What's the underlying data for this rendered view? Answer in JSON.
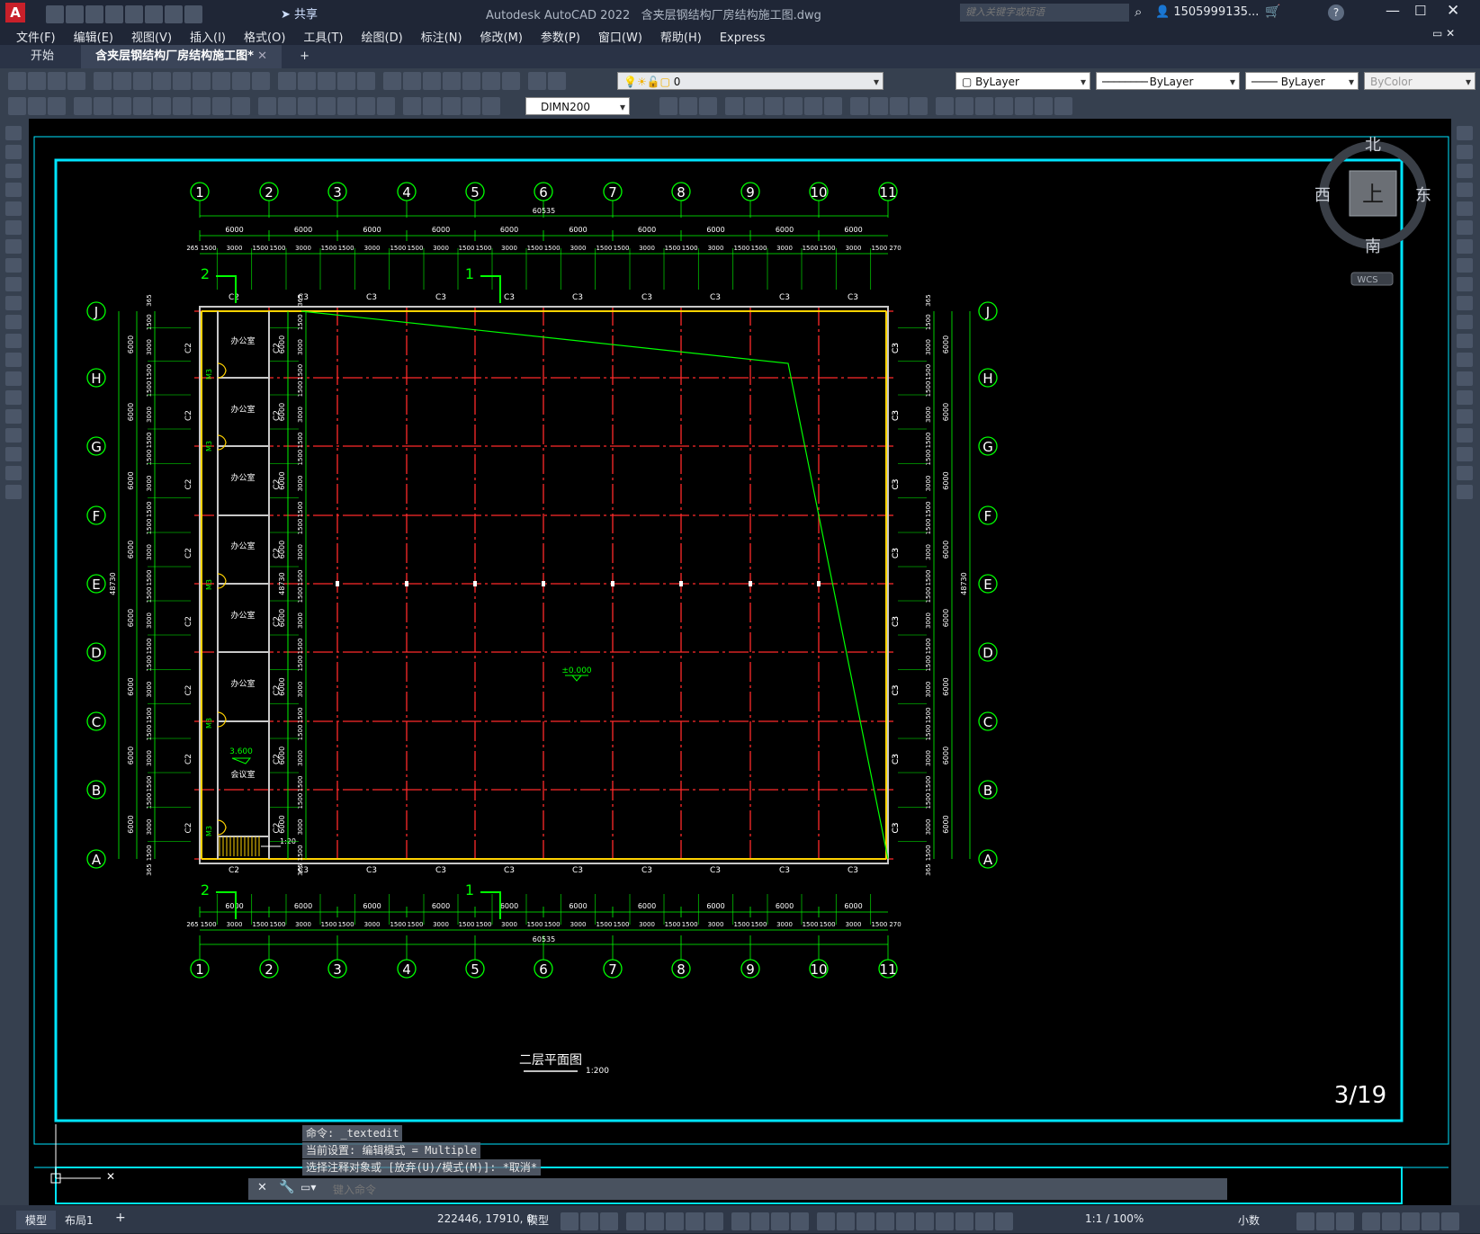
{
  "app": {
    "title": "Autodesk AutoCAD 2022",
    "document": "含夹层钢结构厂房结构施工图.dwg",
    "share_label": "共享",
    "search_placeholder": "键入关键字或短语",
    "user": "1505999135...",
    "accent_color": "#00e5ff"
  },
  "menu": [
    "文件(F)",
    "编辑(E)",
    "视图(V)",
    "插入(I)",
    "格式(O)",
    "工具(T)",
    "绘图(D)",
    "标注(N)",
    "修改(M)",
    "参数(P)",
    "窗口(W)",
    "帮助(H)",
    "Express"
  ],
  "tabs": [
    {
      "label": "开始"
    },
    {
      "label": "含夹层钢结构厂房结构施工图*"
    }
  ],
  "properties": {
    "layer": "0",
    "color": "ByLayer",
    "linetype": "ByLayer",
    "lineweight": "ByLayer",
    "plotstyle": "ByColor",
    "dimstyle": "DIMN200"
  },
  "viewcube": {
    "north": "北",
    "south": "南",
    "east": "东",
    "west": "西",
    "top": "上",
    "wcs": "WCS"
  },
  "drawing": {
    "title": "二层平面图",
    "scale": "1:200",
    "sheet": "3/19",
    "grid_cols": [
      "1",
      "2",
      "3",
      "4",
      "5",
      "6",
      "7",
      "8",
      "9",
      "10",
      "11"
    ],
    "grid_rows": [
      "J",
      "H",
      "G",
      "F",
      "E",
      "D",
      "C",
      "B",
      "A"
    ],
    "total_width": "60535",
    "total_depth": "48730",
    "bay_width": "6000",
    "bay_depth": "6000",
    "elevation_label": "±0.000",
    "mezzanine_level": "3.600",
    "room_office": "办公室",
    "room_meeting": "会议室",
    "door_tag": "M3",
    "stair_slope": "1:20",
    "section_marks": [
      "1",
      "2"
    ],
    "column_tags": [
      "C2",
      "C3"
    ],
    "bay_splits": [
      "1500",
      "3000",
      "1500"
    ],
    "end_dims": [
      "265",
      "270"
    ],
    "edge_dim": "365"
  },
  "command_history": [
    "命令: _textedit",
    "当前设置: 编辑模式 = Multiple",
    "选择注释对象或 [放弃(U)/模式(M)]: *取消*"
  ],
  "command_placeholder": "键入命令",
  "status": {
    "coords": "222446, 17910, 0",
    "model_label": "模型",
    "scale": "1:1 / 100%",
    "units": "小数",
    "layout_tabs": [
      "模型",
      "布局1"
    ]
  }
}
